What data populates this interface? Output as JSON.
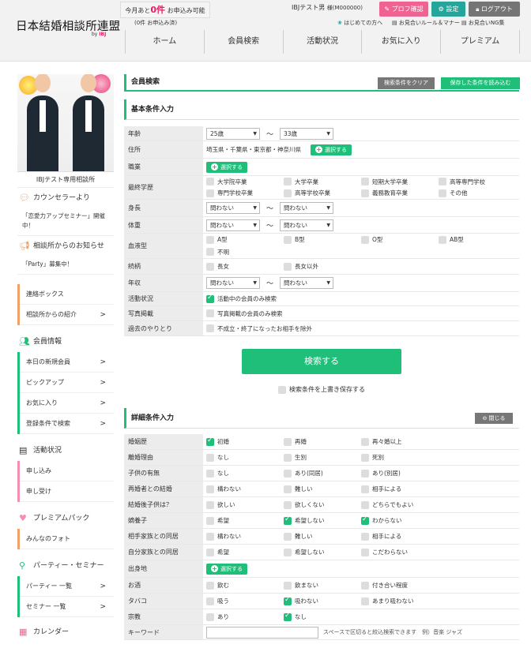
{
  "header": {
    "logo": "日本結婚相談所連盟",
    "logo_sub_by": "by",
    "logo_sub_brand": "IBJ",
    "quota_pre": "今月あと",
    "quota_num": "0件",
    "quota_post": "お申込み可能",
    "quota_note": "(0件 お申込み済)",
    "user_name": "IBJテスト男",
    "user_id": "様(M000000)",
    "btn_profile": "プロフ確認",
    "btn_settings": "設定",
    "btn_logout": "ログアウト",
    "link_beginner": "はじめての方へ",
    "link_rules": "お見合いルール＆マナー",
    "link_ng": "お見合いNG集"
  },
  "nav": [
    "ホーム",
    "会員検索",
    "活動状況",
    "お気に入り",
    "プレミアム"
  ],
  "sidebar": {
    "avatar_caption": "IBJテスト専用相談所",
    "counselor_title": "カウンセラーより",
    "counselor_text": "「恋愛力アップセミナー」開催中！",
    "notice_title": "相談所からのお知らせ",
    "notice_text": "「Party」募集中！",
    "list1": [
      {
        "label": "連絡ボックス"
      },
      {
        "label": "相談所からの紹介"
      }
    ],
    "member_title": "会員情報",
    "list2": [
      {
        "label": "本日の新規会員"
      },
      {
        "label": "ピックアップ"
      },
      {
        "label": "お気に入り"
      },
      {
        "label": "登録条件で検索"
      }
    ],
    "activity_title": "活動状況",
    "list3": [
      {
        "label": "申し込み"
      },
      {
        "label": "申し受け"
      }
    ],
    "premium_title": "プレミアムパック",
    "list4": [
      {
        "label": "みんなのフォト"
      }
    ],
    "party_title": "パーティー・セミナー",
    "list5": [
      {
        "label": "パーティー 一覧"
      },
      {
        "label": "セミナー 一覧"
      }
    ],
    "calendar_title": "カレンダー"
  },
  "main": {
    "title": "会員検索",
    "btn_clear": "検索条件をクリア",
    "btn_load": "保存した条件を読み込む",
    "basic_title": "基本条件入力",
    "search_button": "検索する",
    "save_label": "検索条件を上書き保存する",
    "detail_title": "詳細条件入力",
    "close_label": "閉じる",
    "select_button": "選択する"
  },
  "basic": {
    "age": {
      "label": "年齢",
      "from": "25歳",
      "to": "33歳"
    },
    "address": {
      "label": "住所",
      "value": "埼玉県・千葉県・東京都・神奈川県"
    },
    "job": {
      "label": "職業"
    },
    "education": {
      "label": "最終学歴",
      "options": [
        "大学院卒業",
        "大学卒業",
        "短期大学卒業",
        "高等専門学校",
        "専門学校卒業",
        "高等学校卒業",
        "義務教育卒業",
        "その他"
      ]
    },
    "height": {
      "label": "身長",
      "from": "問わない",
      "to": "問わない"
    },
    "weight": {
      "label": "体重",
      "from": "問わない",
      "to": "問わない"
    },
    "blood": {
      "label": "血液型",
      "options": [
        "A型",
        "B型",
        "O型",
        "AB型",
        "不明"
      ]
    },
    "sibling": {
      "label": "続柄",
      "options": [
        "長女",
        "長女以外"
      ]
    },
    "income": {
      "label": "年収",
      "from": "問わない",
      "to": "問わない"
    },
    "activity": {
      "label": "活動状況",
      "option": "活動中の会員のみ検索"
    },
    "photo": {
      "label": "写真掲載",
      "option": "写真掲載の会員のみ検索"
    },
    "history": {
      "label": "過去のやりとり",
      "option": "不成立・終了になったお相手を除外"
    }
  },
  "detail": [
    {
      "label": "婚姻歴",
      "options": [
        "初婚",
        "再婚",
        "再々婚以上"
      ],
      "checked": [
        true,
        false,
        false
      ]
    },
    {
      "label": "離婚理由",
      "options": [
        "なし",
        "生別",
        "死別"
      ],
      "checked": [
        false,
        false,
        false
      ]
    },
    {
      "label": "子供の有無",
      "options": [
        "なし",
        "あり(同居)",
        "あり(別居)"
      ],
      "checked": [
        false,
        false,
        false
      ]
    },
    {
      "label": "再婚者との結婚",
      "options": [
        "構わない",
        "難しい",
        "相手による"
      ],
      "checked": [
        false,
        false,
        false
      ]
    },
    {
      "label": "結婚後子供は？",
      "options": [
        "欲しい",
        "欲しくない",
        "どちらでもよい"
      ],
      "checked": [
        false,
        false,
        false
      ]
    },
    {
      "label": "嫡養子",
      "options": [
        "希望",
        "希望しない",
        "わからない"
      ],
      "checked": [
        false,
        true,
        true
      ]
    },
    {
      "label": "相手家族との同居",
      "options": [
        "構わない",
        "難しい",
        "相手による"
      ],
      "checked": [
        false,
        false,
        false
      ]
    },
    {
      "label": "自分家族との同居",
      "options": [
        "希望",
        "希望しない",
        "こだわらない"
      ],
      "checked": [
        false,
        false,
        false
      ]
    }
  ],
  "detail_birth": {
    "label": "出身地"
  },
  "detail2": [
    {
      "label": "お酒",
      "options": [
        "飲む",
        "飲まない",
        "付き合い程度"
      ],
      "checked": [
        false,
        false,
        false
      ]
    },
    {
      "label": "タバコ",
      "options": [
        "吸う",
        "吸わない",
        "あまり吸わない"
      ],
      "checked": [
        false,
        true,
        false
      ]
    },
    {
      "label": "宗教",
      "options": [
        "あり",
        "なし"
      ],
      "checked": [
        false,
        true
      ]
    }
  ],
  "keyword": {
    "label": "キーワード",
    "hint": "スペースで区切ると絞込検索できます　例）音楽 ジャズ"
  }
}
